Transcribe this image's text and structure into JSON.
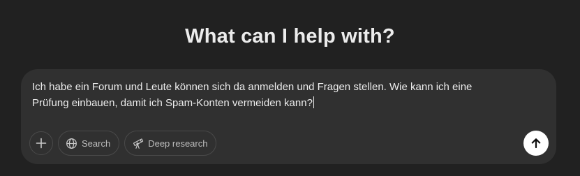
{
  "heading": "What can I help with?",
  "composer": {
    "prompt_line1": "Ich habe ein Forum und Leute können sich da anmelden und Fragen stellen. Wie kann ich eine",
    "prompt_line2": "Prüfung einbauen, damit ich Spam-Konten vermeiden kann?"
  },
  "toolbar": {
    "add_icon": "plus-icon",
    "search_label": "Search",
    "search_icon": "globe-icon",
    "deep_research_label": "Deep research",
    "deep_research_icon": "telescope-icon",
    "send_icon": "arrow-up-icon"
  },
  "colors": {
    "background": "#212121",
    "composer": "#303030",
    "text": "#ececec",
    "send_button": "#ffffff"
  }
}
